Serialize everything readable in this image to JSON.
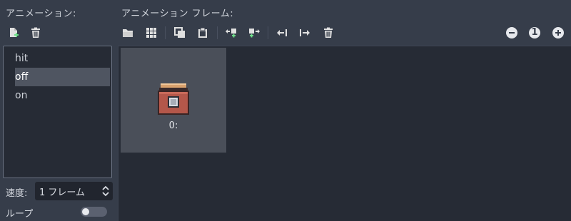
{
  "left_panel": {
    "header": "アニメーション:",
    "animations": [
      "hit",
      "off",
      "on"
    ],
    "selected_index": 1,
    "speed_label": "速度:",
    "speed_value": "1 フレーム",
    "loop_label": "ループ",
    "loop_enabled": false
  },
  "right_panel": {
    "header": "アニメーション フレーム:",
    "frames": [
      {
        "label": "0:"
      }
    ],
    "zoom_reset_label": "1"
  },
  "colors": {
    "background": "#363d4a",
    "panel": "#262b35",
    "selected": "#4f5561",
    "accent_green": "#6fe08a"
  },
  "icons": {
    "new_animation": "new-file-icon",
    "remove_animation": "trash-icon",
    "load_frames": "folder-icon",
    "sprite_sheet": "grid-icon",
    "copy": "copy-icon",
    "paste": "paste-icon",
    "insert_before": "insert-before-icon",
    "insert_after": "insert-after-icon",
    "move_left": "move-left-icon",
    "move_right": "move-right-icon",
    "delete_frame": "trash-icon",
    "zoom_out": "zoom-out-icon",
    "zoom_reset": "zoom-reset-icon",
    "zoom_in": "zoom-in-icon"
  }
}
